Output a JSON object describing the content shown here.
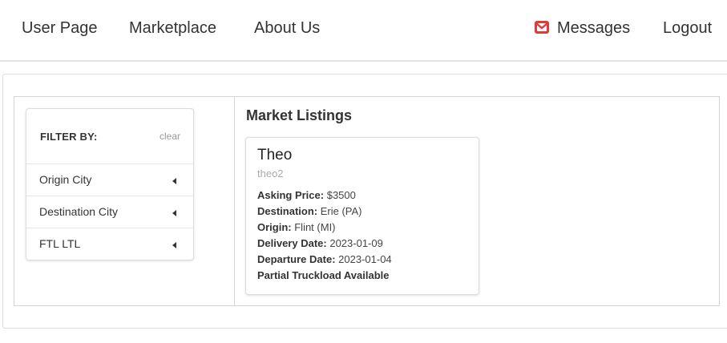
{
  "nav": {
    "user_page": "User Page",
    "marketplace": "Marketplace",
    "about_us": "About Us",
    "messages": "Messages",
    "logout": "Logout",
    "messages_icon": "envelope-icon",
    "accent_color": "#e03b3b"
  },
  "filter": {
    "title": "FILTER BY:",
    "clear": "clear",
    "items": [
      {
        "label": "Origin City",
        "icon": "caret-left-icon"
      },
      {
        "label": "Destination City",
        "icon": "caret-left-icon"
      },
      {
        "label": "FTL LTL",
        "icon": "caret-left-icon"
      }
    ]
  },
  "listings": {
    "title": "Market Listings",
    "cards": [
      {
        "name": "Theo",
        "username": "theo2",
        "asking_price_label": "Asking Price:",
        "asking_price": "$3500",
        "destination_label": "Destination:",
        "destination": "Erie (PA)",
        "origin_label": "Origin:",
        "origin": "Flint (MI)",
        "delivery_date_label": "Delivery Date:",
        "delivery_date": "2023-01-09",
        "departure_date_label": "Departure Date:",
        "departure_date": "2023-01-04",
        "load_note": "Partial Truckload Available"
      }
    ]
  }
}
